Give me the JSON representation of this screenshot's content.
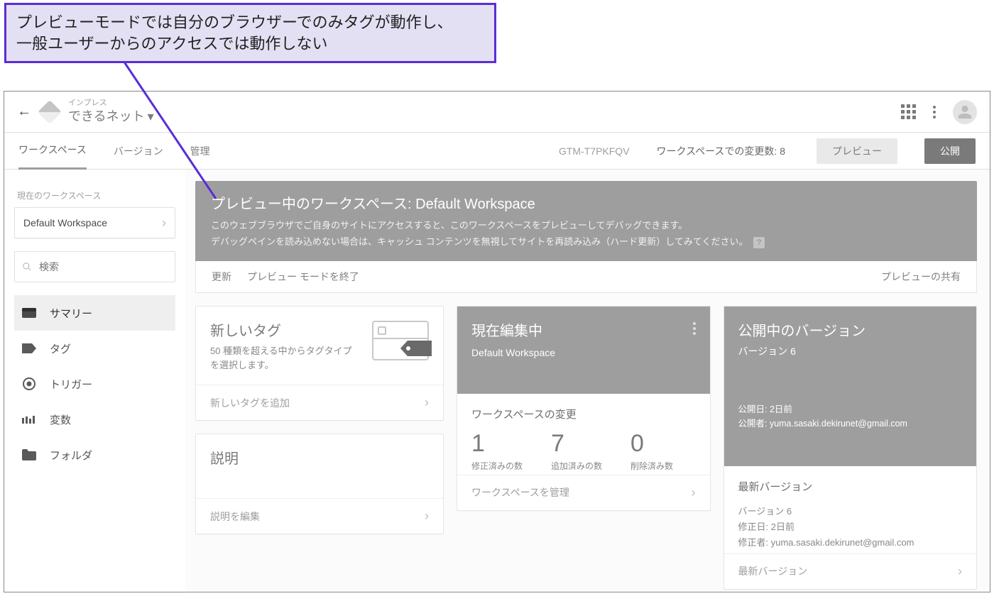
{
  "callout": {
    "line1": "プレビューモードでは自分のブラウザーでのみタグが動作し、",
    "line2": "一般ユーザーからのアクセスでは動作しない"
  },
  "header": {
    "account": "インプレス",
    "site": "できるネット"
  },
  "subbar": {
    "tabs": [
      "ワークスペース",
      "バージョン",
      "管理"
    ],
    "container_id": "GTM-T7PKFQV",
    "changes_label": "ワークスペースでの変更数: 8",
    "preview_btn": "プレビュー",
    "publish_btn": "公開"
  },
  "sidebar": {
    "section_label": "現在のワークスペース",
    "workspace": "Default Workspace",
    "search_placeholder": "検索",
    "items": [
      "サマリー",
      "タグ",
      "トリガー",
      "変数",
      "フォルダ"
    ]
  },
  "banner": {
    "title_prefix": "プレビュー中のワークスペース:",
    "title_ws": "Default Workspace",
    "line1": "このウェブブラウザでご自身のサイトにアクセスすると、このワークスペースをプレビューしてデバッグできます。",
    "line2": "デバッグペインを読み込めない場合は、キャッシュ コンテンツを無視してサイトを再読み込み（ハード更新）してみてください。",
    "bar": {
      "refresh": "更新",
      "exit": "プレビュー モードを終了",
      "share": "プレビューの共有"
    }
  },
  "cards": {
    "newtag": {
      "title": "新しいタグ",
      "desc": "50 種類を超える中からタグタイプを選択します。",
      "action": "新しいタグを追加"
    },
    "desc": {
      "title": "説明",
      "action": "説明を編集"
    },
    "editing": {
      "title": "現在編集中",
      "workspace": "Default Workspace",
      "changes_title": "ワークスペースの変更",
      "counts": [
        {
          "n": "1",
          "t": "修正済みの数"
        },
        {
          "n": "7",
          "t": "追加済みの数"
        },
        {
          "n": "0",
          "t": "削除済み数"
        }
      ],
      "action": "ワークスペースを管理"
    },
    "live": {
      "title": "公開中のバージョン",
      "version": "バージョン 6",
      "pubdate": "公開日: 2日前",
      "publisher": "公開者: yuma.sasaki.dekirunet@gmail.com",
      "latest_label": "最新バージョン",
      "latest_ver": "バージョン 6",
      "moddate": "修正日: 2日前",
      "modby": "修正者: yuma.sasaki.dekirunet@gmail.com",
      "action": "最新バージョン"
    }
  }
}
